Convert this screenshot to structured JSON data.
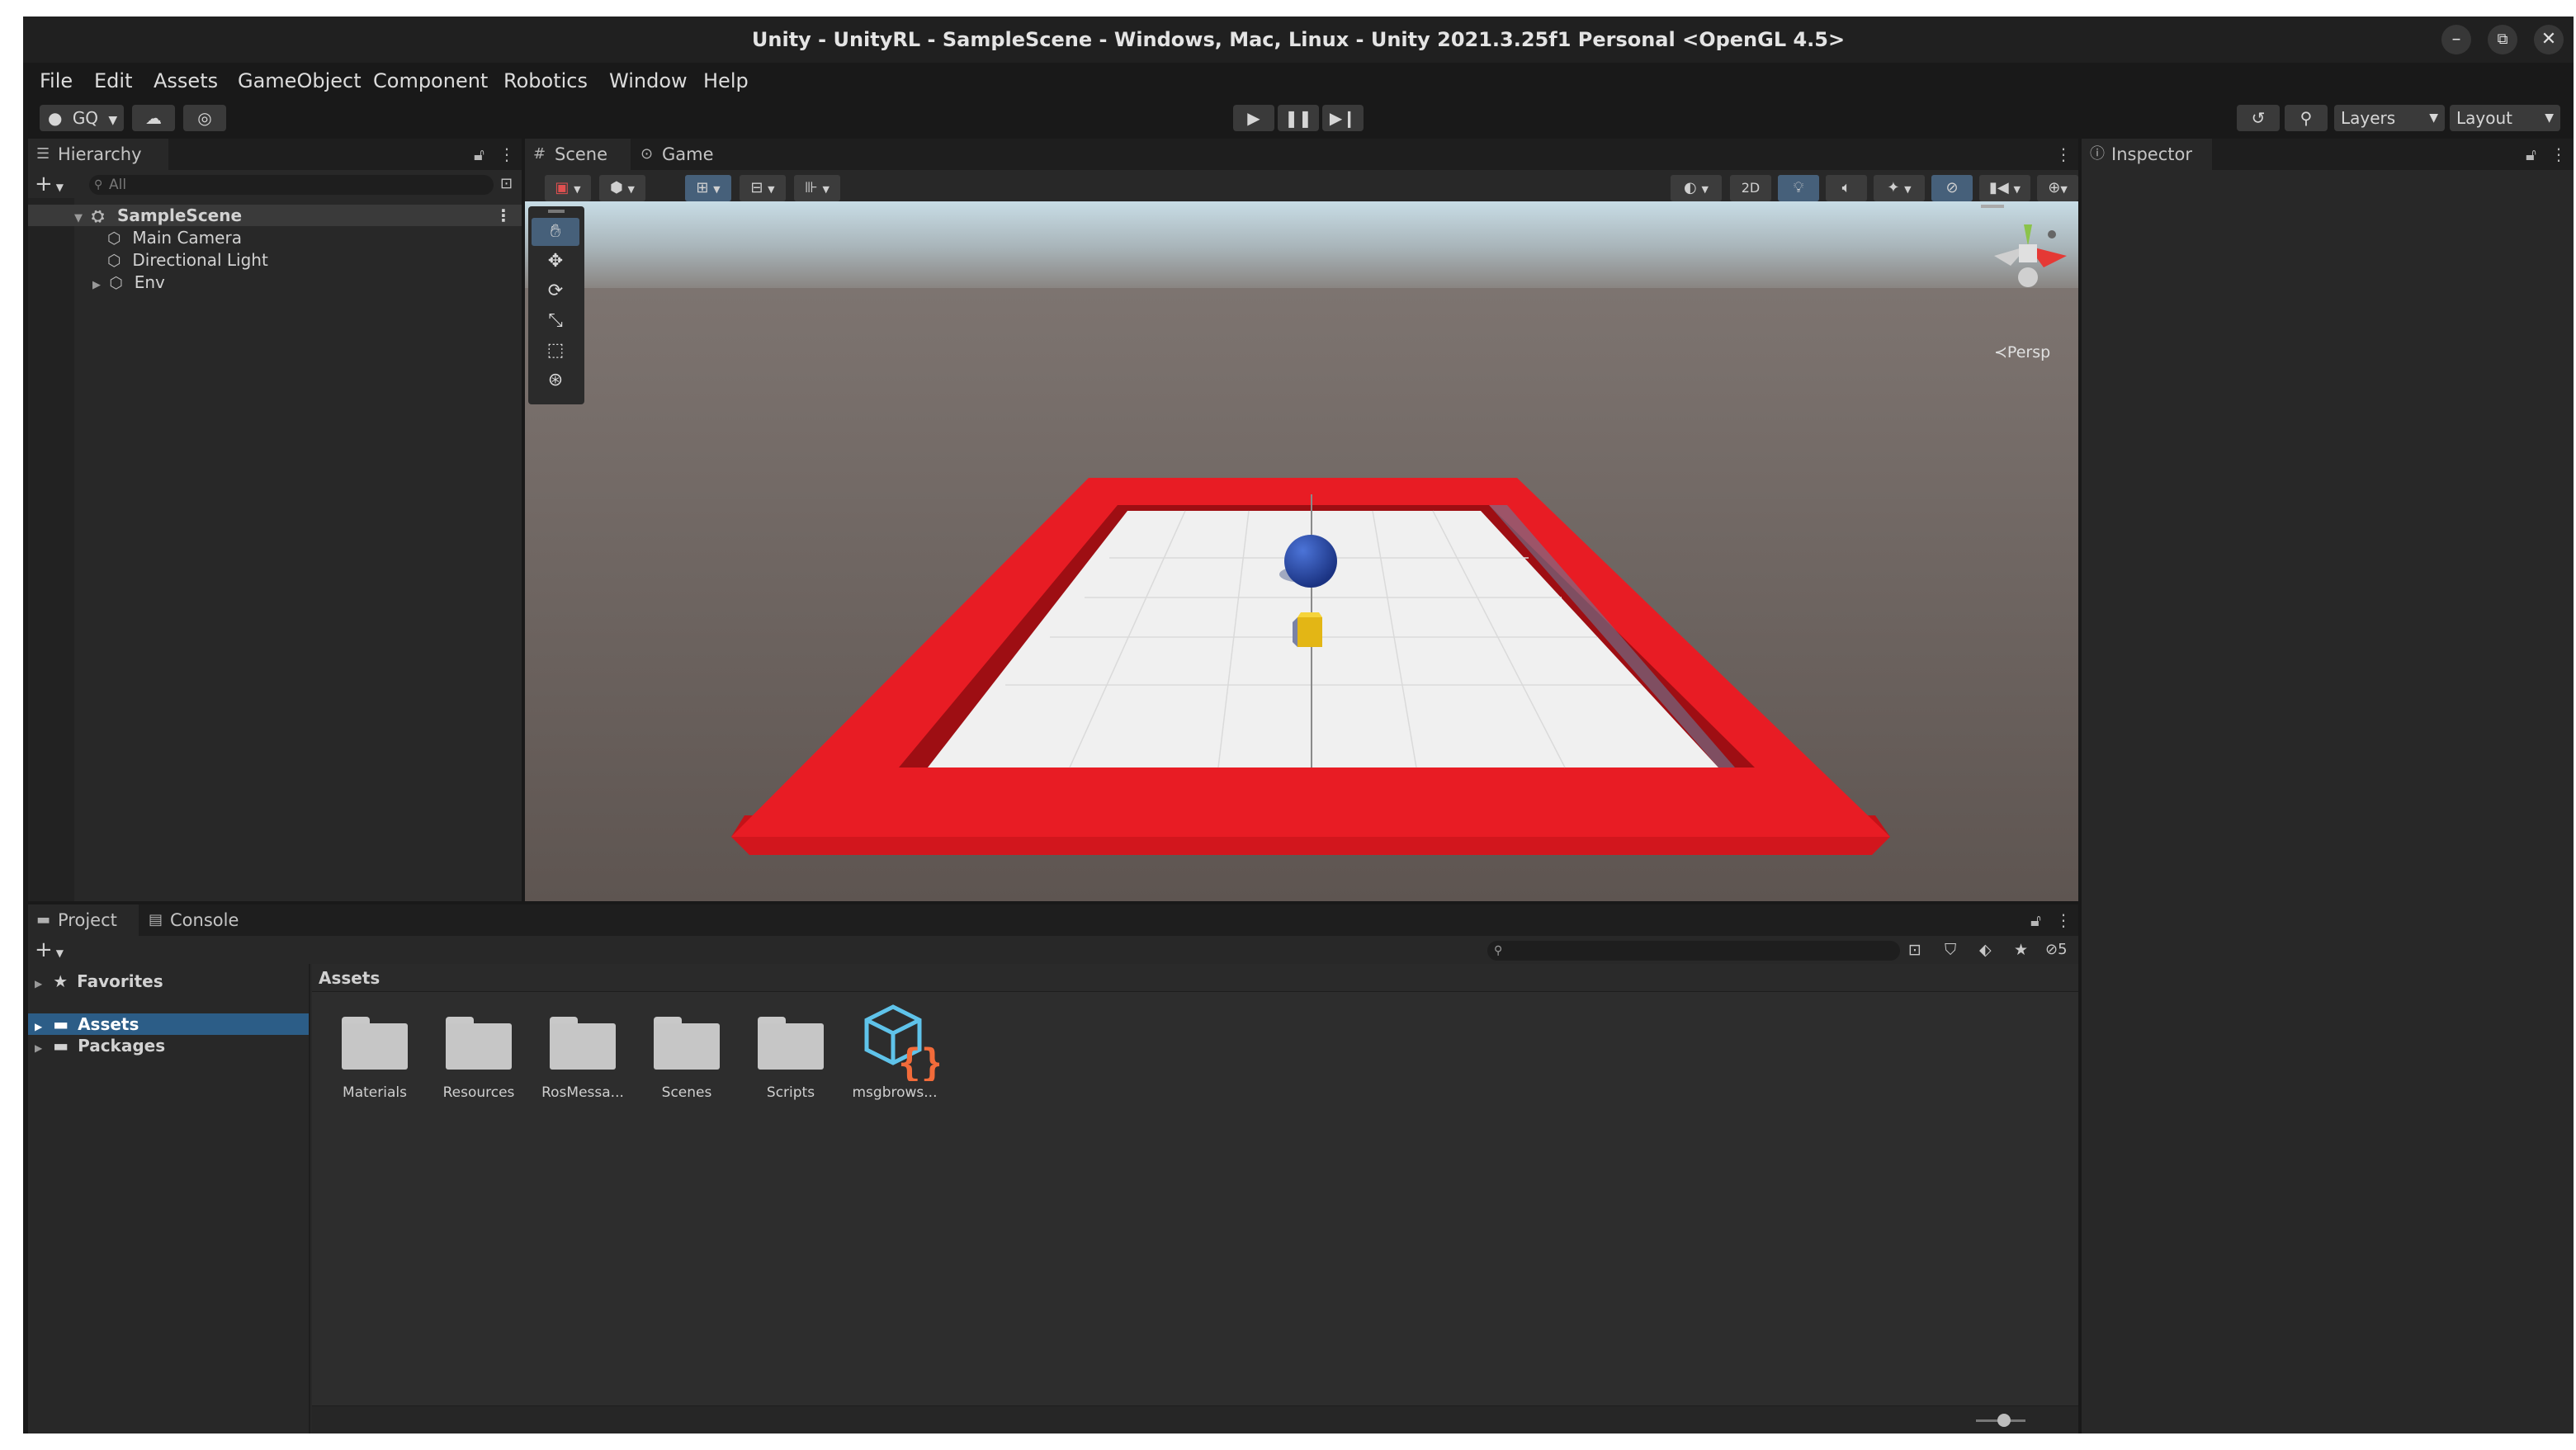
{
  "window": {
    "title": "Unity - UnityRL - SampleScene - Windows, Mac, Linux - Unity 2021.3.25f1 Personal <OpenGL 4.5>",
    "minimize_glyph": "–",
    "maximize_glyph": "⧉",
    "close_glyph": "✕"
  },
  "menubar": [
    "File",
    "Edit",
    "Assets",
    "GameObject",
    "Component",
    "Robotics",
    "Window",
    "Help"
  ],
  "toolbar": {
    "account": "GQ",
    "layers": "Layers",
    "layout": "Layout"
  },
  "hierarchy": {
    "tab": "Hierarchy",
    "search_placeholder": "All",
    "items": [
      {
        "label": "SampleScene"
      },
      {
        "label": "Main Camera"
      },
      {
        "label": "Directional Light"
      },
      {
        "label": "Env"
      }
    ]
  },
  "scene": {
    "tabs": [
      "Scene",
      "Game"
    ],
    "toolbar_2d": "2D",
    "persp": "Persp"
  },
  "inspector": {
    "tab": "Inspector"
  },
  "project": {
    "tabs": [
      "Project",
      "Console"
    ],
    "sidebar": {
      "favorites": "Favorites",
      "assets": "Assets",
      "packages": "Packages"
    },
    "breadcrumb": "Assets",
    "hidden_count": "5",
    "items": [
      {
        "label": "Materials",
        "kind": "folder"
      },
      {
        "label": "Resources",
        "kind": "folder"
      },
      {
        "label": "RosMessa...",
        "kind": "folder"
      },
      {
        "label": "Scenes",
        "kind": "folder"
      },
      {
        "label": "Scripts",
        "kind": "folder"
      },
      {
        "label": "msgbrows...",
        "kind": "prefab-script"
      }
    ]
  },
  "colors": {
    "accent_selection": "#2c5d87",
    "wall_red": "#e81c24",
    "sphere_blue": "#2747a8",
    "cube_yellow": "#f0c419",
    "floor": "#f0f0f0"
  }
}
